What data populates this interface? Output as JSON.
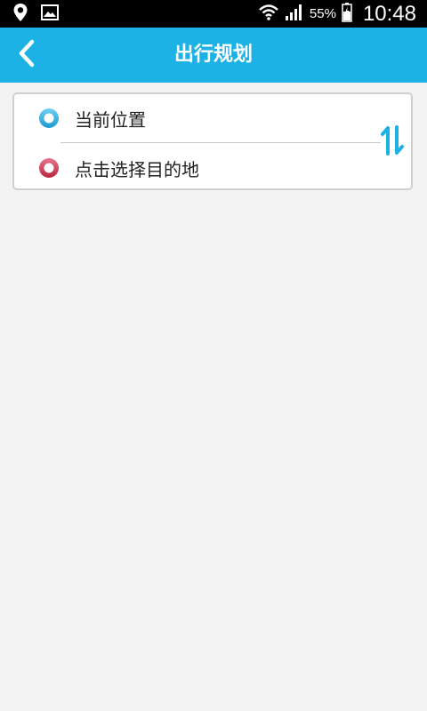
{
  "status_bar": {
    "left_icons": [
      "location-pin-icon",
      "image-icon"
    ],
    "battery_percent": "55%",
    "time": "10:48",
    "right_icons": [
      "wifi-icon",
      "signal-icon",
      "battery-icon"
    ]
  },
  "header": {
    "title": "出行规划",
    "back_icon": "chevron-left-icon",
    "background_color": "#1cb2e6"
  },
  "route": {
    "start_label": "当前位置",
    "destination_label": "点击选择目的地",
    "start_dot_color": "#1ea8dc",
    "destination_dot_color": "#c8354f",
    "swap_icon": "swap-arrows-icon",
    "accent_color": "#1cb2e6"
  }
}
